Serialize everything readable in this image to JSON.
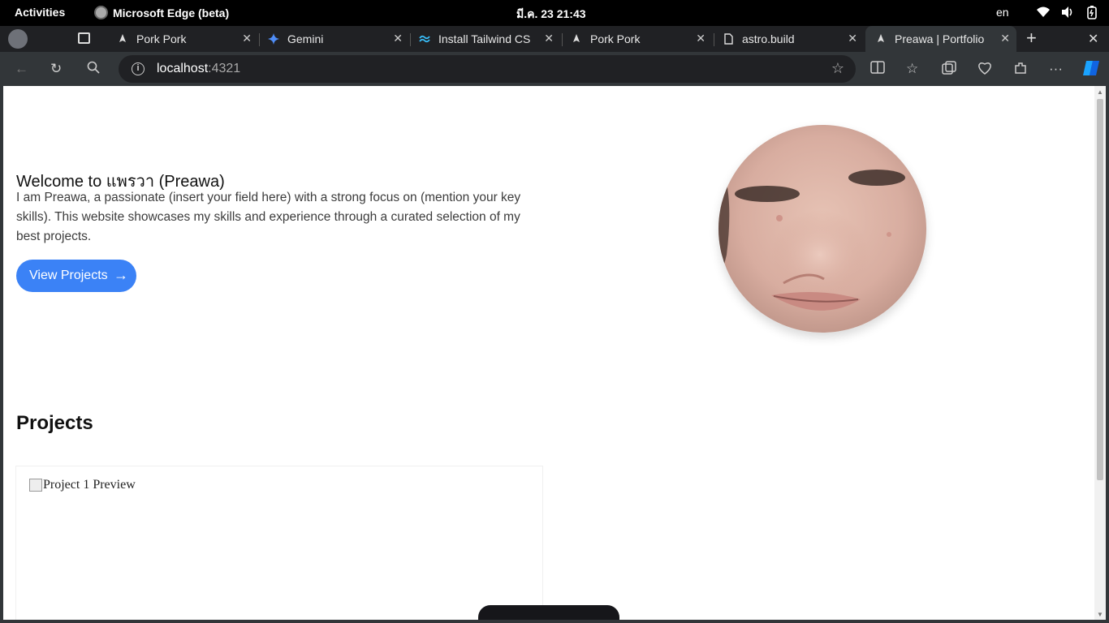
{
  "system_bar": {
    "activities": "Activities",
    "app_name": "Microsoft Edge (beta)",
    "clock": "มี.ค. 23  21:43",
    "lang": "en"
  },
  "tabs": [
    {
      "title": "Pork Pork"
    },
    {
      "title": "Gemini"
    },
    {
      "title": "Install Tailwind CS"
    },
    {
      "title": "Pork Pork"
    },
    {
      "title": "astro.build"
    },
    {
      "title": "Preawa | Portfolio"
    }
  ],
  "address_bar": {
    "host": "localhost",
    "port": ":4321"
  },
  "page": {
    "hero": {
      "title": "Welcome to แพรวา (Preawa)",
      "text": "I am Preawa, a passionate (insert your field here) with a strong focus on (mention your key skills). This website showcases my skills and experience through a curated selection of my best projects.",
      "button": "View Projects"
    },
    "projects": {
      "heading": "Projects",
      "cards": [
        {
          "image_alt": "Project 1 Preview"
        }
      ]
    }
  },
  "colors": {
    "accent": "#3b82f6",
    "chrome_dark": "#202124",
    "chrome": "#323639"
  }
}
